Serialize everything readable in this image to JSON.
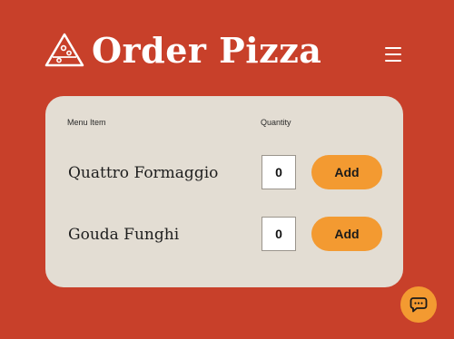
{
  "header": {
    "title": "Order Pizza",
    "logo_icon": "pizza-slice-icon",
    "menu_icon": "hamburger-menu-icon"
  },
  "table": {
    "columns": {
      "item": "Menu Item",
      "quantity": "Quantity"
    },
    "rows": [
      {
        "name": "Quattro Formaggio",
        "quantity": "0",
        "add_label": "Add"
      },
      {
        "name": "Gouda Funghi",
        "quantity": "0",
        "add_label": "Add"
      }
    ]
  },
  "chat": {
    "icon": "chat-bubble-icon"
  },
  "colors": {
    "background": "#c8402a",
    "card": "#e3ddd3",
    "accent": "#f39a31",
    "text_light": "#ffffff"
  }
}
